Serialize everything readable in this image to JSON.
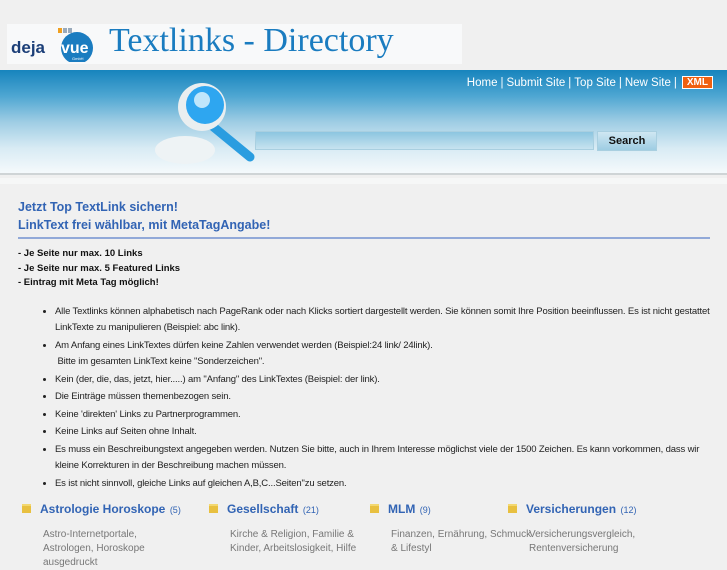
{
  "header": {
    "logo_text": "deja vue GmbH",
    "title": "Textlinks  -  Directory"
  },
  "nav": {
    "items": [
      "Home",
      "Submit Site",
      "Top Site",
      "New Site"
    ],
    "separator": "|",
    "xml_label": "XML"
  },
  "search": {
    "value": "",
    "button_label": "Search"
  },
  "promo": {
    "line1": "Jetzt Top TextLink sichern!",
    "line2": "LinkText frei wählbar, mit MetaTagAngabe!"
  },
  "features": [
    "- Je Seite nur max. 10 Links",
    "- Je Seite nur max. 5 Featured Links",
    "- Eintrag mit Meta Tag möglich!"
  ],
  "rules": [
    "Alle Textlinks können alphabetisch nach PageRank oder nach Klicks sortiert dargestellt werden. Sie können somit Ihre Position beeinflussen. Es ist nicht gestattet LinkTexte zu manipulieren (Beispiel: abc link).",
    "Am Anfang eines LinkTextes dürfen keine Zahlen verwendet werden (Beispiel:24 link/ 24link).",
    "Kein (der, die, das, jetzt, hier.....) am \"Anfang\" des LinkTextes (Beispiel: der link).",
    "Die Einträge müssen themenbezogen sein.",
    "Keine 'direkten' Links zu Partnerprogrammen.",
    "Keine Links auf Seiten ohne Inhalt.",
    "Es muss ein Beschreibungstext angegeben werden. Nutzen Sie bitte, auch in Ihrem Interesse möglichst viele der 1500 Zeichen. Es kann vorkommen, dass wir kleine Korrekturen in der Beschreibung machen müssen.",
    "Es ist nicht sinnvoll, gleiche Links auf gleichen A,B,C...Seiten\"zu setzen."
  ],
  "rule2_extra": "Bitte im gesamten LinkText keine \"Sonderzeichen\".",
  "categories": [
    {
      "title": "Astrologie Horoskope",
      "count": "(5)",
      "desc": "Astro-Internetportale, Astrologen, Horoskope ausgedruckt"
    },
    {
      "title": "Gesellschaft",
      "count": "(21)",
      "desc": "Kirche & Religion, Familie & Kinder, Arbeitslosigkeit, Hilfe"
    },
    {
      "title": "MLM",
      "count": "(9)",
      "desc": "Finanzen, Ernährung, Schmuck & Lifestyl"
    },
    {
      "title": "Versicherungen",
      "count": "(12)",
      "desc": "Versicherungsvergleich, Rentenversicherung"
    }
  ],
  "colors": {
    "accent": "#3264b4",
    "banner": "#1784bd",
    "xml": "#f06010"
  }
}
